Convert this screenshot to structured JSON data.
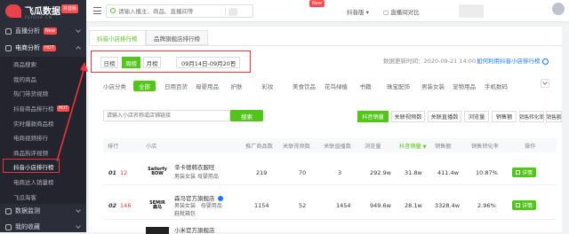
{
  "brand": {
    "name": "飞瓜数据",
    "badge": "抖音版",
    "sub": "FEIGUA.CN"
  },
  "sidebar": {
    "top_items": [
      {
        "label": "直播分析",
        "badge": "New"
      },
      {
        "label": "电商分析",
        "badge": "HOT"
      }
    ],
    "sub_items": [
      {
        "label": "商品搜索"
      },
      {
        "label": "我的商品"
      },
      {
        "label": "热门带货视频"
      },
      {
        "label": "抖音商品排行榜",
        "badge": "HOT"
      },
      {
        "label": "实时爆款商品榜"
      },
      {
        "label": "电商视频排行"
      },
      {
        "label": "商品热评视频"
      },
      {
        "label": "抖音小店排行榜"
      },
      {
        "label": "电商达人销量榜"
      },
      {
        "label": "飞瓜淘客"
      }
    ],
    "bottom_items": [
      {
        "label": "数据监测"
      },
      {
        "label": "我的收藏"
      }
    ]
  },
  "topbar": {
    "search_placeholder": "请输入播主、商品、直播间等",
    "new_badge": "New",
    "platform": "抖音版",
    "live_camera": "直播间对比"
  },
  "tabs": [
    "抖音小店排行榜",
    "品牌旗舰店排行榜"
  ],
  "period": {
    "options": [
      "日榜",
      "周榜",
      "月榜"
    ],
    "selected": "周榜",
    "date_range": "09月14日-09月20日"
  },
  "update_time": "数据更新时间：2020-09-21 14:00",
  "help_link": "如何利用抖音小店排行榜",
  "categories": {
    "label": "小店分类",
    "items": [
      "全部",
      "日用百货",
      "母婴用品",
      "护肤",
      "彩妆",
      "美食饮品",
      "花鸟绿植",
      "书籍",
      "珠宝配饰",
      "男装女装",
      "宠物用品",
      "手机数码"
    ],
    "selected": "全部"
  },
  "shop_search": {
    "placeholder": "请输入小店名称或店铺链接",
    "button": "搜索"
  },
  "sort_buttons": [
    "抖音销量",
    "关联视频数",
    "关联直播数",
    "浏览量",
    "销售额",
    "销售转化率",
    "销售额"
  ],
  "sort_selected": "抖音销量",
  "table": {
    "columns": [
      "排行",
      "小店",
      "推广商品数",
      "关联视频数",
      "关联直播数",
      "浏览量",
      "抖音销量",
      "销售额",
      "销售转化率",
      "操作"
    ],
    "rows": [
      {
        "rank": "01",
        "change": "12",
        "logo": "Sailorfy\nBOW",
        "name": "辛卡德韩衣服旺",
        "tags": "男装女装   母婴用品",
        "products": "219",
        "videos": "70",
        "lives": "3",
        "views": "292.9w",
        "sales": "31.8w",
        "revenue": "411.4w",
        "conversion": "10.87%",
        "action": "详情"
      },
      {
        "rank": "02",
        "change": "146",
        "logo": "SEMIR\n森马",
        "name": "森马官方旗舰店",
        "tags": "男装女装   母婴用品\n鞋靴箱包",
        "products": "1154",
        "videos": "52",
        "lives": "1454",
        "views": "949.6w",
        "sales": "28.1w",
        "revenue": "3328.4w",
        "conversion": "2.96%",
        "action": "详情"
      }
    ],
    "partial_row": {
      "name": "小米官方旗舰店"
    }
  },
  "colors": {
    "accent": "#52c41a",
    "highlight": "#e8343a",
    "sidebar": "#2b2d38"
  }
}
